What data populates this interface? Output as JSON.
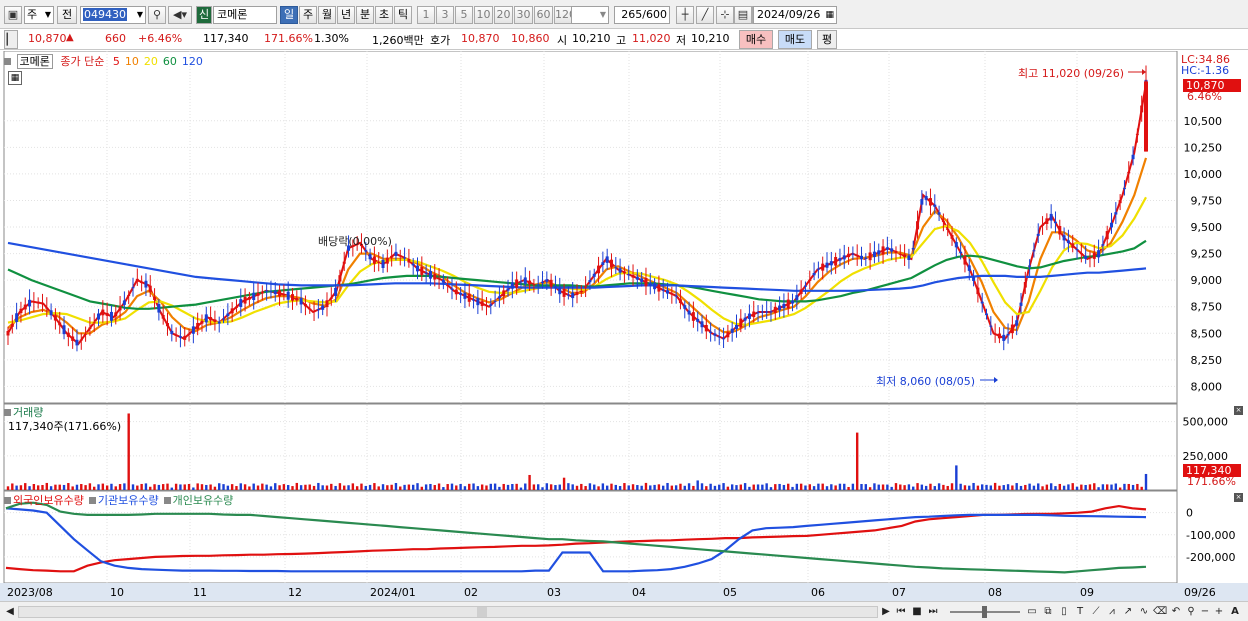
{
  "toolbar": {
    "period_label": "주",
    "prev_label": "전",
    "stock_code": "049430",
    "shin_label": "신",
    "stock_name": "코메론",
    "tabs": [
      "일",
      "주",
      "월",
      "년",
      "분",
      "초",
      "틱"
    ],
    "active_tab": 0,
    "intervals": [
      "1",
      "3",
      "5",
      "10",
      "20",
      "30",
      "60",
      "120"
    ],
    "count": "265",
    "count_max": "/600",
    "date": "2024/09/26"
  },
  "info": {
    "price": "10,870",
    "change": "660",
    "change_pct": "+6.46%",
    "volume": "117,340",
    "volume_ratio": "171.66%",
    "turnover_rate": "1.30%",
    "amount": "1,260백만",
    "quote_label": "호가",
    "ask": "10,870",
    "bid": "10,860",
    "open_label": "시",
    "open": "10,210",
    "high_label": "고",
    "high": "11,020",
    "low_label": "저",
    "low": "10,210",
    "buy_label": "매수",
    "sell_label": "매도",
    "avg_label": "평"
  },
  "legend": {
    "name_box": "코메론",
    "price_type": "종가 단순",
    "ma": [
      {
        "period": "5",
        "color": "#e01010"
      },
      {
        "period": "10",
        "color": "#f08000"
      },
      {
        "period": "20",
        "color": "#f0e000"
      },
      {
        "period": "60",
        "color": "#109040"
      },
      {
        "period": "120",
        "color": "#2050e0"
      }
    ],
    "lc": "LC:34.86",
    "hc": "HC:-1.36",
    "last_price_tag": "10,870",
    "last_pct_tag": "6.46%",
    "high_annot": "최고 11,020 (09/26)",
    "low_annot": "최저 8,060 (08/05)",
    "dividend_annot": "배당락(0.00%)",
    "volume_title": "거래량",
    "volume_value": "117,340주(171.66%)",
    "volume_tag": "117,340",
    "volume_pct_tag": "171.66%",
    "holding_labels": [
      "외국인보유수량",
      "기관보유수량",
      "개인보유수량"
    ],
    "holding_colors": [
      "#e01010",
      "#2050e0",
      "#2a8a50"
    ]
  },
  "colors": {
    "up": "#e01010",
    "down": "#1a3fd4",
    "grid": "#c8c8c8"
  },
  "chart_data": {
    "type": "candlestick",
    "price_axis": {
      "ylim": [
        7900,
        11100
      ],
      "ticks": [
        "8,000",
        "8,250",
        "8,500",
        "8,750",
        "9,000",
        "9,250",
        "9,500",
        "9,750",
        "10,000",
        "10,250",
        "10,500"
      ]
    },
    "volume_axis": {
      "ylim": [
        0,
        600000
      ],
      "ticks": [
        "500,000",
        "250,000"
      ]
    },
    "holding_axis": {
      "ylim": [
        -300000,
        80000
      ],
      "ticks": [
        "0",
        "-100,000",
        "-200,000"
      ]
    },
    "x_labels": [
      "2023/08",
      "10",
      "11",
      "12",
      "2024/01",
      "02",
      "03",
      "04",
      "05",
      "06",
      "07",
      "08",
      "09",
      "09/26"
    ],
    "ma_series": [
      {
        "name": "5",
        "values": [
          8500,
          8700,
          8800,
          8780,
          8650,
          8500,
          8400,
          8550,
          8700,
          8650,
          8800,
          9000,
          8950,
          8700,
          8500,
          8450,
          8550,
          8650,
          8600,
          8700,
          8800,
          8850,
          8900,
          8880,
          8850,
          8800,
          8700,
          8750,
          8900,
          9300,
          9350,
          9200,
          9150,
          9250,
          9200,
          9100,
          9050,
          9000,
          8900,
          8850,
          8800,
          8750,
          8850,
          8950,
          9000,
          8950,
          9000,
          8900,
          8850,
          8900,
          9050,
          9200,
          9100,
          9050,
          9000,
          8950,
          8900,
          8850,
          8700,
          8600,
          8500,
          8450,
          8550,
          8650,
          8700,
          8700,
          8750,
          8800,
          8950,
          9100,
          9150,
          9200,
          9250,
          9200,
          9250,
          9300,
          9250,
          9200,
          9800,
          9700,
          9500,
          9300,
          9100,
          8800,
          8500,
          8450,
          8600,
          9100,
          9500,
          9600,
          9400,
          9300,
          9200,
          9250,
          9500,
          9800,
          10200,
          10850
        ]
      },
      {
        "name": "10",
        "values": [
          8550,
          8650,
          8700,
          8720,
          8680,
          8600,
          8500,
          8500,
          8580,
          8620,
          8700,
          8850,
          8900,
          8800,
          8650,
          8550,
          8520,
          8580,
          8600,
          8650,
          8720,
          8780,
          8830,
          8850,
          8850,
          8830,
          8780,
          8760,
          8820,
          9100,
          9250,
          9250,
          9200,
          9200,
          9200,
          9150,
          9080,
          9030,
          8950,
          8880,
          8830,
          8790,
          8820,
          8880,
          8940,
          8960,
          8980,
          8940,
          8880,
          8880,
          8970,
          9100,
          9130,
          9080,
          9030,
          8980,
          8930,
          8880,
          8780,
          8680,
          8580,
          8510,
          8520,
          8580,
          8650,
          8680,
          8720,
          8750,
          8850,
          8980,
          9080,
          9150,
          9200,
          9210,
          9230,
          9260,
          9260,
          9230,
          9500,
          9650,
          9560,
          9400,
          9200,
          8980,
          8700,
          8550,
          8530,
          8800,
          9200,
          9450,
          9450,
          9380,
          9280,
          9250,
          9350,
          9550,
          9800,
          10150
        ]
      },
      {
        "name": "20",
        "values": [
          8600,
          8620,
          8650,
          8680,
          8690,
          8680,
          8640,
          8600,
          8600,
          8610,
          8640,
          8720,
          8790,
          8800,
          8760,
          8700,
          8640,
          8610,
          8600,
          8610,
          8650,
          8700,
          8740,
          8780,
          8800,
          8810,
          8800,
          8790,
          8800,
          8950,
          9080,
          9150,
          9180,
          9190,
          9190,
          9170,
          9130,
          9090,
          9040,
          8980,
          8930,
          8890,
          8880,
          8880,
          8900,
          8920,
          8940,
          8940,
          8920,
          8910,
          8940,
          9010,
          9060,
          9070,
          9060,
          9030,
          9000,
          8960,
          8890,
          8810,
          8720,
          8640,
          8590,
          8580,
          8600,
          8620,
          8650,
          8680,
          8740,
          8820,
          8900,
          8990,
          9060,
          9110,
          9150,
          9190,
          9210,
          9220,
          9350,
          9480,
          9510,
          9460,
          9350,
          9180,
          8980,
          8790,
          8680,
          8700,
          8900,
          9120,
          9280,
          9350,
          9340,
          9300,
          9320,
          9420,
          9580,
          9780
        ]
      },
      {
        "name": "60",
        "values": [
          9100,
          9050,
          9000,
          8960,
          8920,
          8880,
          8840,
          8800,
          8780,
          8760,
          8740,
          8730,
          8730,
          8740,
          8750,
          8760,
          8770,
          8790,
          8810,
          8830,
          8850,
          8870,
          8890,
          8900,
          8910,
          8920,
          8930,
          8940,
          8950,
          8960,
          8980,
          9000,
          9020,
          9030,
          9040,
          9040,
          9040,
          9030,
          9020,
          9010,
          9000,
          8990,
          8980,
          8970,
          8960,
          8950,
          8950,
          8950,
          8950,
          8940,
          8940,
          8950,
          8960,
          8970,
          8970,
          8970,
          8960,
          8950,
          8940,
          8920,
          8900,
          8880,
          8860,
          8840,
          8820,
          8810,
          8800,
          8800,
          8800,
          8810,
          8830,
          8850,
          8880,
          8900,
          8930,
          8960,
          8990,
          9020,
          9080,
          9140,
          9190,
          9220,
          9230,
          9220,
          9190,
          9160,
          9130,
          9110,
          9120,
          9150,
          9180,
          9200,
          9220,
          9230,
          9250,
          9270,
          9300,
          9370
        ]
      },
      {
        "name": "120",
        "values": [
          9350,
          9330,
          9310,
          9290,
          9270,
          9250,
          9230,
          9210,
          9190,
          9170,
          9150,
          9130,
          9110,
          9090,
          9070,
          9050,
          9030,
          9020,
          9010,
          9000,
          8990,
          8980,
          8970,
          8960,
          8955,
          8950,
          8950,
          8950,
          8950,
          8950,
          8955,
          8960,
          8965,
          8970,
          8970,
          8970,
          8970,
          8965,
          8960,
          8955,
          8950,
          8945,
          8940,
          8935,
          8930,
          8930,
          8930,
          8930,
          8930,
          8930,
          8930,
          8935,
          8940,
          8945,
          8950,
          8950,
          8950,
          8950,
          8945,
          8940,
          8935,
          8930,
          8925,
          8920,
          8915,
          8910,
          8905,
          8900,
          8900,
          8900,
          8900,
          8900,
          8900,
          8905,
          8910,
          8915,
          8920,
          8930,
          8950,
          8980,
          9000,
          9020,
          9030,
          9040,
          9040,
          9040,
          9030,
          9030,
          9030,
          9040,
          9050,
          9060,
          9070,
          9070,
          9080,
          9090,
          9100,
          9110
        ]
      }
    ],
    "holding_series": [
      {
        "name": "외국인보유수량",
        "values": [
          -250000,
          -255000,
          -260000,
          -262000,
          -265000,
          -265000,
          -240000,
          -225000,
          -215000,
          -210000,
          -205000,
          -200000,
          -198000,
          -196000,
          -195000,
          -195000,
          -193000,
          -192000,
          -190000,
          -190000,
          -188000,
          -187000,
          -185000,
          -183000,
          -180000,
          -178000,
          -175000,
          -172000,
          -170000,
          -168000,
          -165000,
          -165000,
          -162000,
          -160000,
          -158000,
          -156000,
          -155000,
          -152000,
          -150000,
          -150000,
          -148000,
          -145000,
          -140000,
          -138000,
          -135000,
          -132000,
          -130000,
          -128000,
          -126000,
          -125000,
          -122000,
          -120000,
          -118000,
          -115000,
          -115000,
          -112000,
          -110000,
          -108000,
          -106000,
          -105000,
          -100000,
          -95000,
          -90000,
          -85000,
          -80000,
          -70000,
          -60000,
          -40000,
          -30000,
          -25000,
          -20000,
          -15000,
          -10000,
          -10000,
          -8000,
          -6000,
          -5000,
          -5000,
          -3000,
          0,
          5000,
          20000,
          30000,
          20000,
          15000
        ]
      },
      {
        "name": "기관보유수량",
        "values": [
          20000,
          15000,
          10000,
          0,
          -60000,
          -120000,
          -170000,
          -220000,
          -240000,
          -250000,
          -255000,
          -258000,
          -260000,
          -262000,
          -262000,
          -262000,
          -263000,
          -263000,
          -264000,
          -264000,
          -264000,
          -265000,
          -265000,
          -265000,
          -265000,
          -265000,
          -265000,
          -265000,
          -265000,
          -265000,
          -265000,
          -265000,
          -265000,
          -265000,
          -265000,
          -265000,
          -265000,
          -265000,
          -265000,
          -262000,
          -262000,
          -180000,
          -180000,
          -180000,
          -265000,
          -265000,
          -265000,
          -262000,
          -260000,
          -255000,
          -245000,
          -230000,
          -210000,
          -170000,
          -120000,
          -80000,
          -70000,
          -68000,
          -65000,
          -60000,
          -55000,
          -50000,
          -45000,
          -40000,
          -35000,
          -30000,
          -25000,
          -20000,
          -18000,
          -15000,
          -12000,
          -10000,
          -10000,
          -10000,
          -10000,
          -10000,
          -10000,
          -12000,
          -14000,
          -15000,
          -16000,
          -17000,
          -18000,
          -19000,
          -20000
        ]
      },
      {
        "name": "개인보유수량",
        "values": [
          20000,
          40000,
          45000,
          35000,
          5000,
          -5000,
          -10000,
          -10000,
          -10000,
          -10000,
          -8000,
          -5000,
          -5000,
          -5000,
          -5000,
          -5000,
          -8000,
          -10000,
          -10000,
          -15000,
          -20000,
          -25000,
          -30000,
          -35000,
          -40000,
          -45000,
          -50000,
          -55000,
          -60000,
          -65000,
          -70000,
          -75000,
          -80000,
          -85000,
          -90000,
          -95000,
          -100000,
          -105000,
          -110000,
          -115000,
          -120000,
          -120000,
          -125000,
          -128000,
          -130000,
          -135000,
          -140000,
          -145000,
          -150000,
          -155000,
          -160000,
          -165000,
          -170000,
          -175000,
          -180000,
          -185000,
          -190000,
          -195000,
          -200000,
          -205000,
          -210000,
          -215000,
          -220000,
          -225000,
          -230000,
          -235000,
          -240000,
          -245000,
          -248000,
          -252000,
          -254000,
          -256000,
          -258000,
          -260000,
          -262000,
          -264000,
          -266000,
          -268000,
          -270000,
          -265000,
          -260000,
          -255000,
          -250000,
          -248000,
          -245000
        ]
      }
    ]
  }
}
